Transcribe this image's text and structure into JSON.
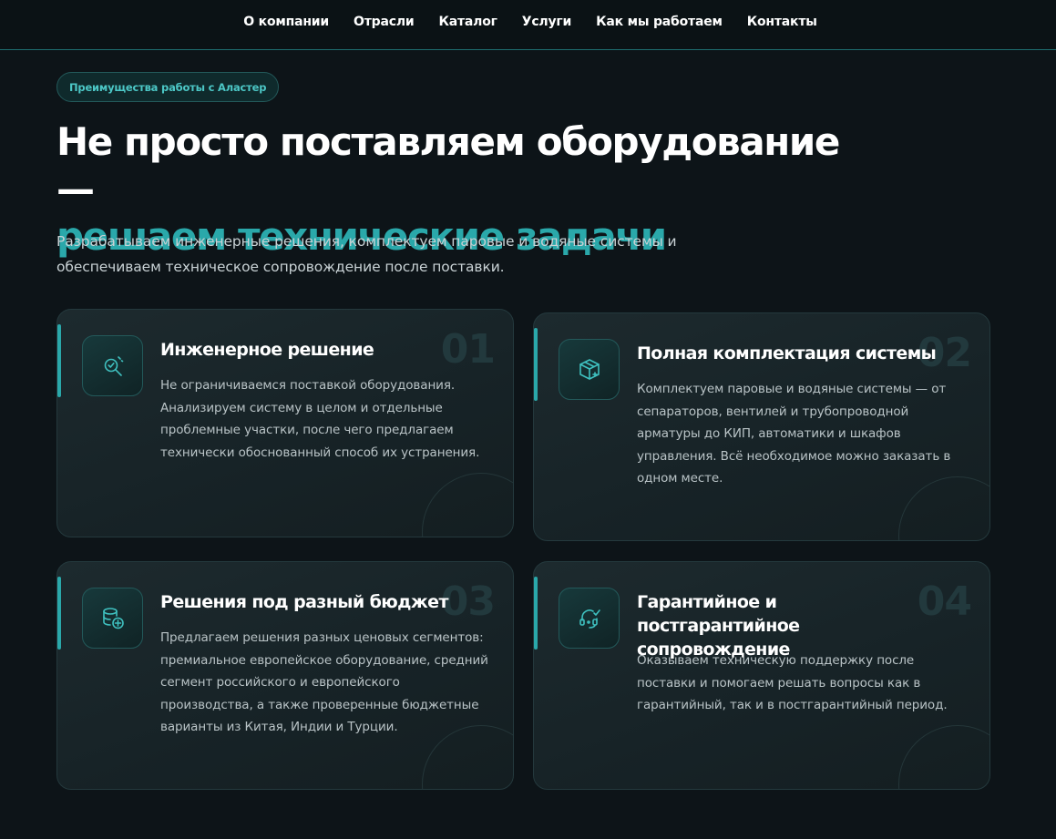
{
  "nav": {
    "items": [
      {
        "label": "О компании"
      },
      {
        "label": "Отрасли"
      },
      {
        "label": "Каталог"
      },
      {
        "label": "Услуги"
      },
      {
        "label": "Как мы работаем"
      },
      {
        "label": "Контакты"
      }
    ]
  },
  "hero": {
    "badge": "Преимущества работы с Аластер",
    "title_line1": "Не просто поставляем оборудование —",
    "title_line2": "решаем технические задачи",
    "subtitle": "Разрабатываем инженерные решения, комплектуем паровые и водяные системы и обеспечиваем техническое сопровождение после поставки."
  },
  "cards": [
    {
      "number": "01",
      "icon": "search-check-icon",
      "title": "Инженерное решение",
      "text": "Не ограничиваемся поставкой оборудования. Анализируем систему в целом и отдельные проблемные участки, после чего предлагаем технически обоснованный способ их устранения."
    },
    {
      "number": "02",
      "icon": "box-plus-icon",
      "title": "Полная комплектация системы",
      "text": "Комплектуем паровые и водяные системы — от сепараторов, вентилей и трубопроводной арматуры до КИП, автоматики и шкафов управления. Всё необходимое можно заказать в одном месте."
    },
    {
      "number": "03",
      "icon": "coins-plus-icon",
      "title": "Решения под разный бюджет",
      "text": "Предлагаем решения разных ценовых сегментов: премиальное европейское оборудование, средний сегмент российского и европейского производства, а также проверенные бюджетные варианты из Китая, Индии и Турции."
    },
    {
      "number": "04",
      "icon": "headset-check-icon",
      "title": "Гарантийное и постгарантийное сопровождение",
      "text": "Оказываем техническую поддержку после поставки и помогаем решать вопросы как в гарантийный, так и в постгарантийный период."
    }
  ],
  "colors": {
    "background": "#0d1418",
    "accent": "#2aa8aa",
    "card_border": "#24393d"
  }
}
